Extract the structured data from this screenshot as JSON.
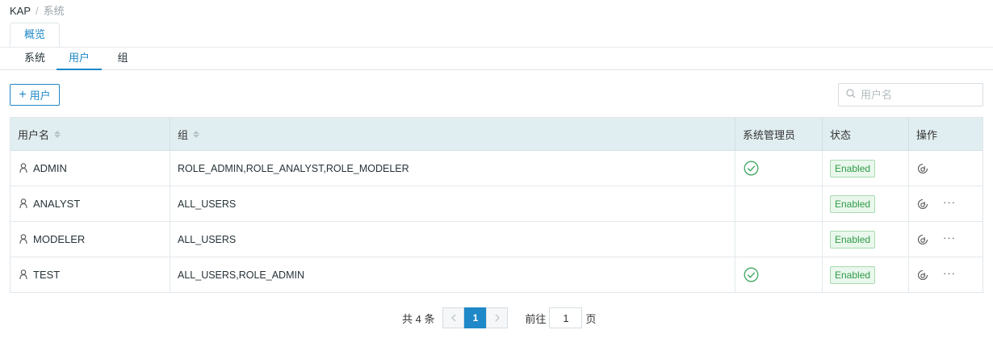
{
  "breadcrumb": {
    "root": "KAP",
    "separator": "/",
    "current": "系统"
  },
  "top_tab": {
    "label": "概览"
  },
  "sub_tabs": [
    {
      "label": "系统"
    },
    {
      "label": "用户"
    },
    {
      "label": "组"
    }
  ],
  "toolbar": {
    "add_user_label": "用户",
    "search_placeholder": "用户名"
  },
  "table": {
    "headers": {
      "username": "用户名",
      "group": "组",
      "admin": "系统管理员",
      "status": "状态",
      "actions": "操作"
    },
    "rows": [
      {
        "username": "ADMIN",
        "groups": "ROLE_ADMIN,ROLE_ANALYST,ROLE_MODELER",
        "is_admin": true,
        "status": "Enabled",
        "has_more": false
      },
      {
        "username": "ANALYST",
        "groups": "ALL_USERS",
        "is_admin": false,
        "status": "Enabled",
        "has_more": true
      },
      {
        "username": "MODELER",
        "groups": "ALL_USERS",
        "is_admin": false,
        "status": "Enabled",
        "has_more": true
      },
      {
        "username": "TEST",
        "groups": "ALL_USERS,ROLE_ADMIN",
        "is_admin": true,
        "status": "Enabled",
        "has_more": true
      }
    ]
  },
  "pagination": {
    "total_text": "共 4 条",
    "current_page": "1",
    "goto_label": "前往",
    "goto_value": "1",
    "page_suffix": "页"
  },
  "colors": {
    "accent": "#1e88c8",
    "header_bg": "#e1eef1",
    "success": "#2e9b48"
  },
  "icons": {
    "user": "user-icon",
    "check": "check-circle-icon",
    "edit": "edit-icon",
    "more": "more-icon"
  }
}
